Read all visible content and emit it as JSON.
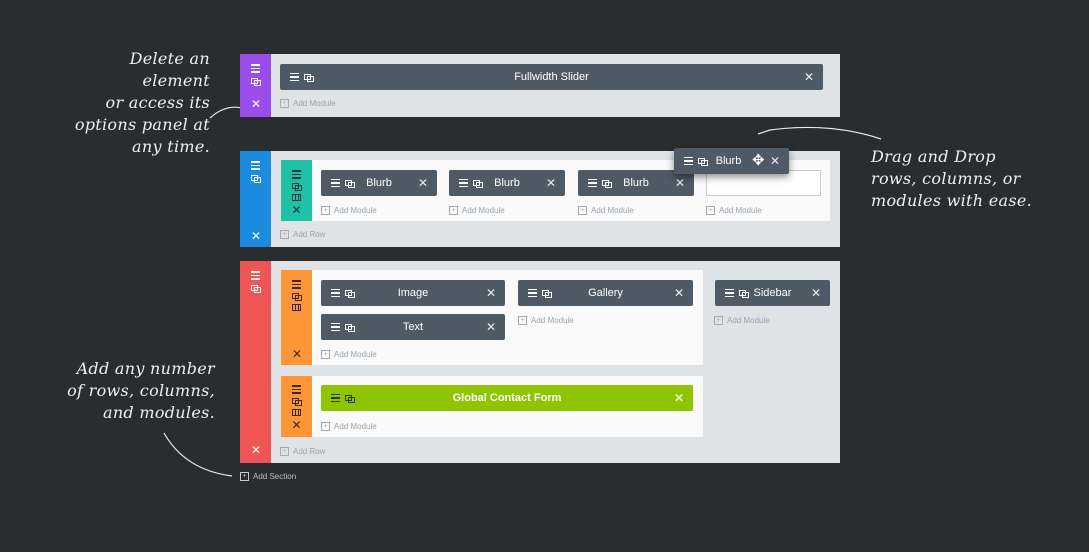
{
  "notes": {
    "delete": [
      "Delete an element",
      "or access its",
      "options panel at",
      "any time."
    ],
    "drag": [
      "Drag and Drop",
      "rows, columns, or",
      "modules with ease."
    ],
    "add": [
      "Add any number",
      "of rows, columns,",
      "and modules."
    ]
  },
  "colors": {
    "section1": "#9b4dea",
    "section2": "#1b8be0",
    "section3": "#ef5555",
    "row_teal": "#1ec1a6",
    "row_orange": "#fe9537",
    "module": "#4e5a65",
    "module_global": "#8ec500",
    "background": "#2a2d30"
  },
  "section1": {
    "module": "Fullwidth Slider",
    "add_module": "Add Module"
  },
  "section2": {
    "modules": [
      "Blurb",
      "Blurb",
      "Blurb"
    ],
    "add_module": "Add Module",
    "add_row": "Add Row",
    "dragging_module": "Blurb"
  },
  "section3": {
    "row1": {
      "col1_modules": [
        "Image",
        "Text"
      ],
      "col2_modules": [
        "Gallery"
      ],
      "add_module": "Add Module"
    },
    "sidebar_module": "Sidebar",
    "row2": {
      "module": "Global Contact Form",
      "add_module": "Add Module"
    },
    "add_row": "Add Row"
  },
  "add_section": "Add Section",
  "icons": {
    "menu": "hamburger-icon",
    "duplicate": "duplicate-icon",
    "columns": "columns-icon",
    "close": "close-icon",
    "move": "move-icon",
    "plus": "plus-icon"
  }
}
